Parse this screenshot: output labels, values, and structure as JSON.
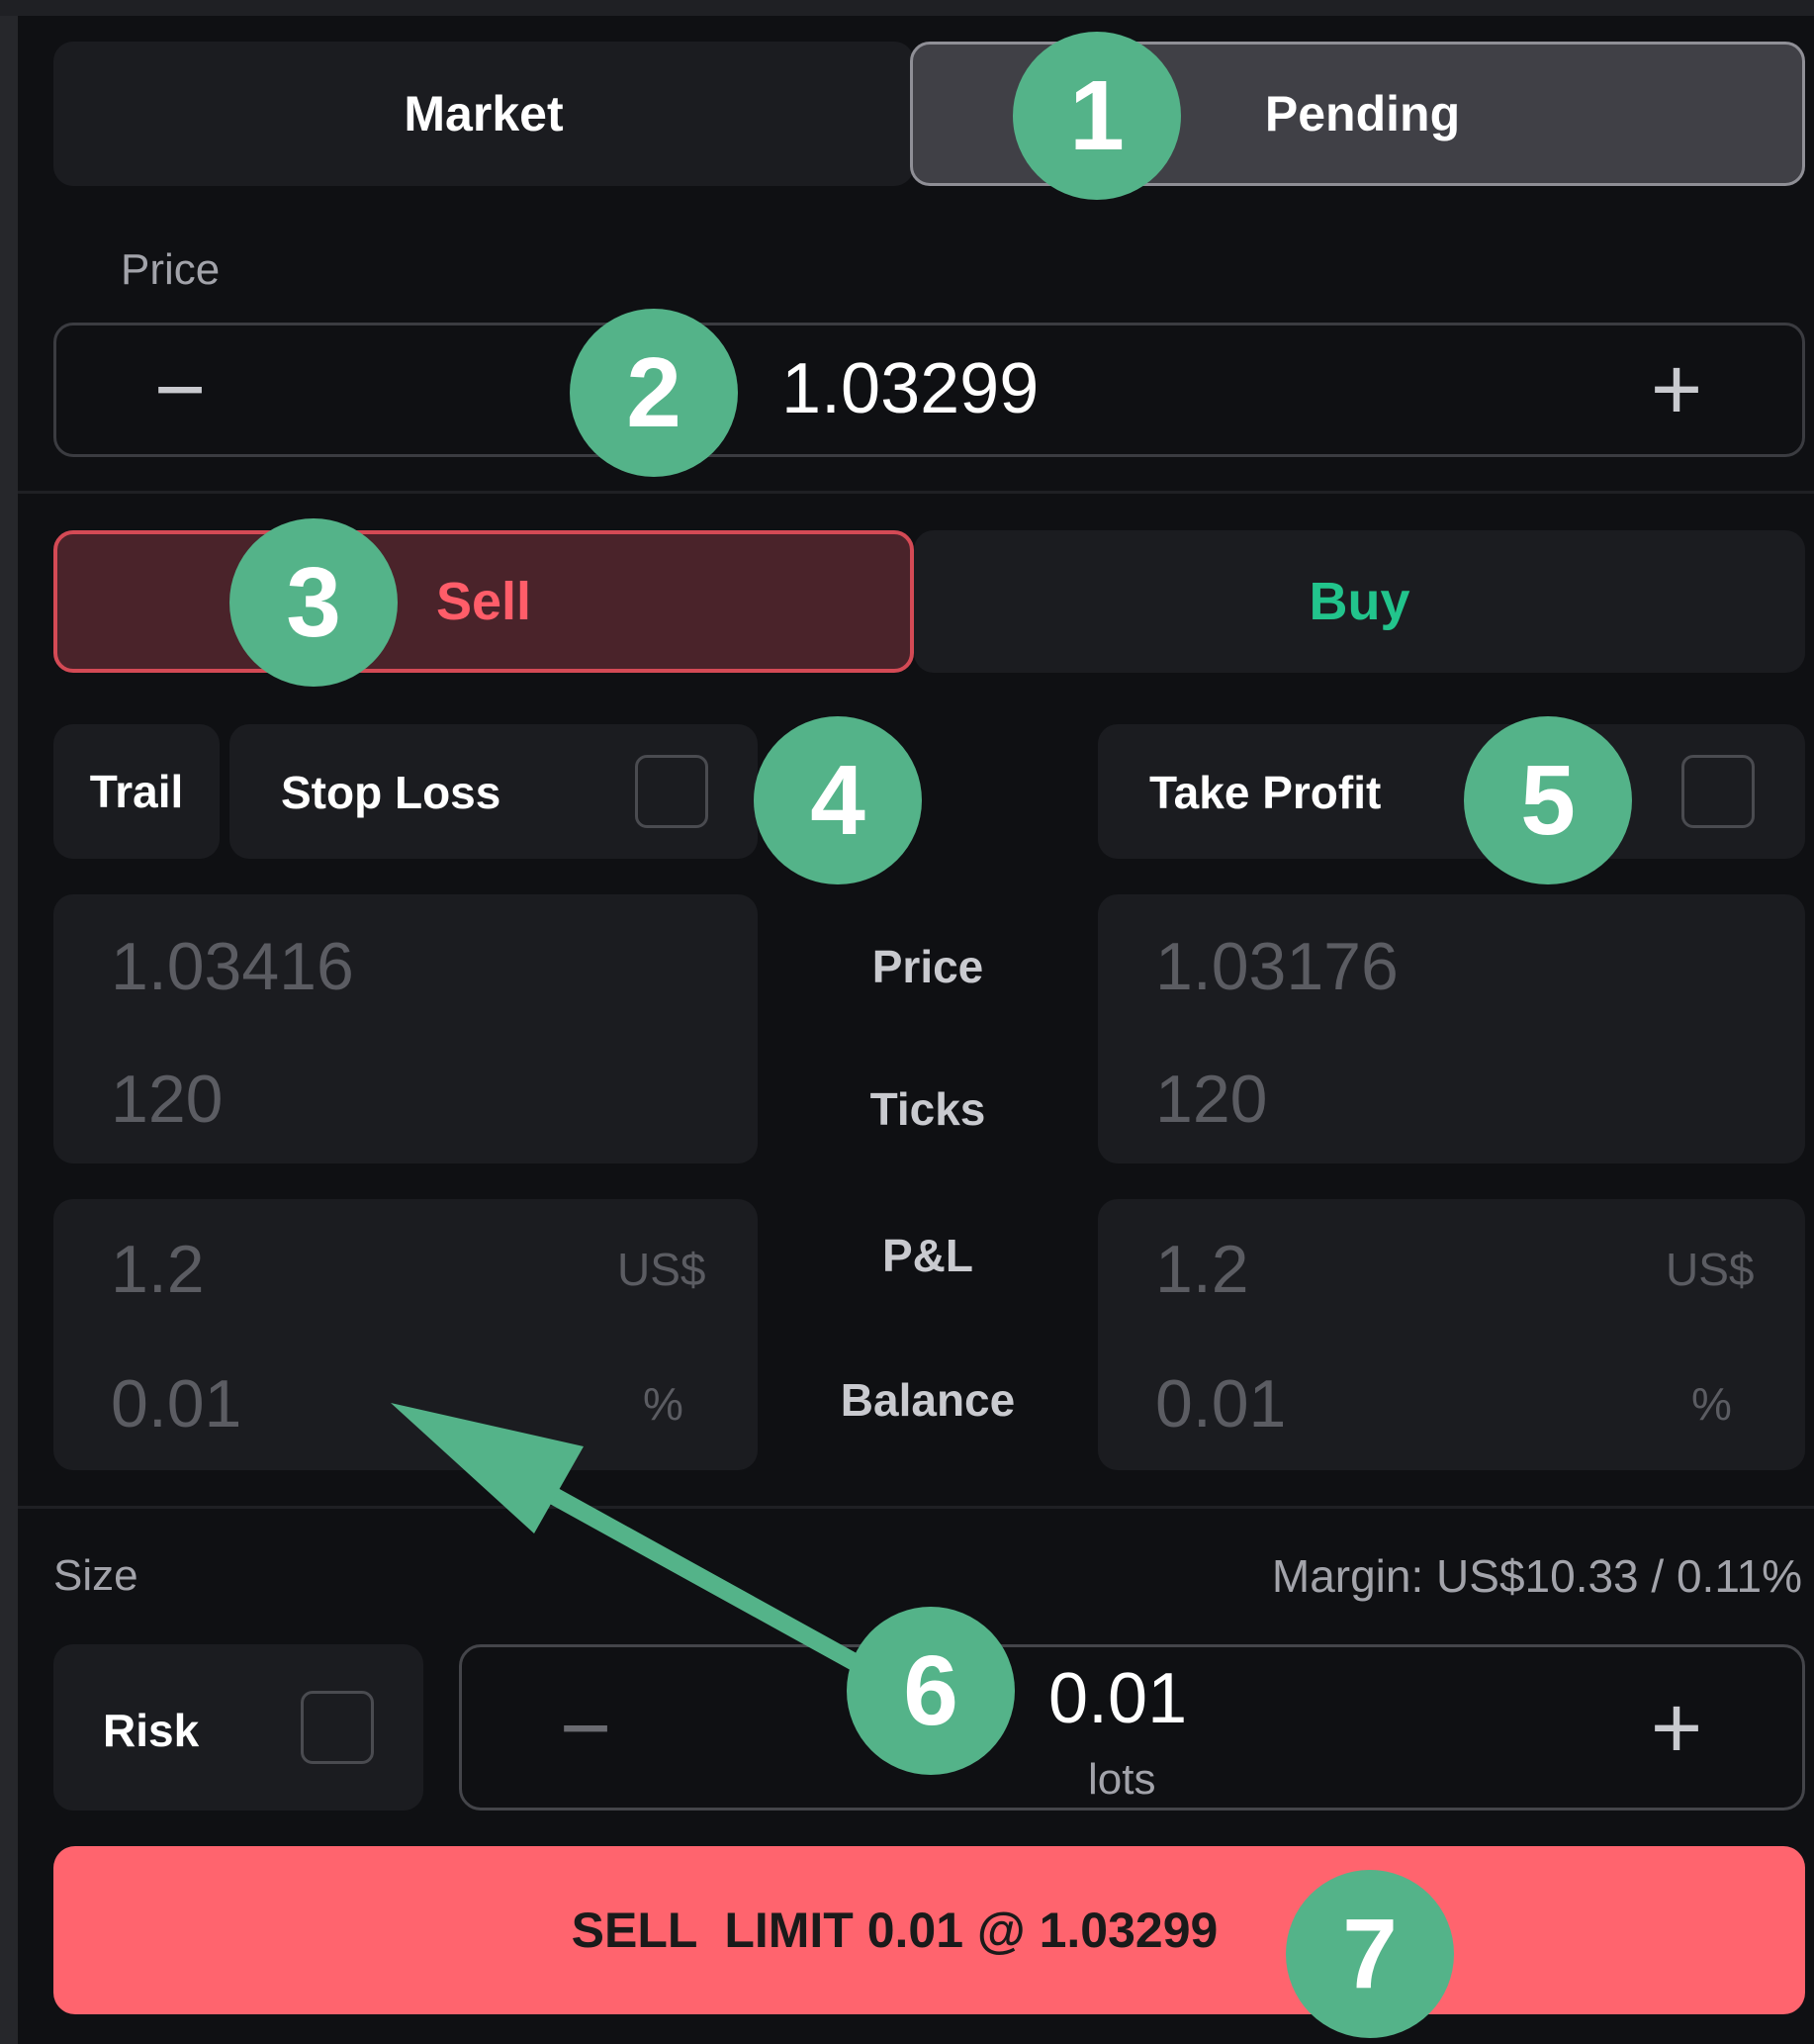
{
  "order_type_tabs": [
    {
      "label": "Market",
      "selected": false
    },
    {
      "label": "Pending",
      "selected": true
    }
  ],
  "price": {
    "label": "Price",
    "value": "1.03299",
    "minus_glyph": "−",
    "plus_glyph": "+"
  },
  "side": {
    "sell_label": "Sell",
    "buy_label": "Buy",
    "selected": "Sell"
  },
  "stop_loss": {
    "trail_label": "Trail",
    "label": "Stop Loss",
    "enabled": false,
    "price": "1.03416",
    "ticks": "120",
    "pnl": "1.2",
    "pnl_unit": "US$",
    "balance": "0.01",
    "balance_unit": "%"
  },
  "take_profit": {
    "label": "Take Profit",
    "enabled": false,
    "price": "1.03176",
    "ticks": "120",
    "pnl": "1.2",
    "pnl_unit": "US$",
    "balance": "0.01",
    "balance_unit": "%"
  },
  "row_labels": {
    "price": "Price",
    "ticks": "Ticks",
    "pnl": "P&L",
    "balance": "Balance"
  },
  "size": {
    "label": "Size",
    "margin": "Margin: US$10.33 / 0.11%",
    "risk_label": "Risk",
    "risk_enabled": false,
    "value": "0.01",
    "unit": "lots",
    "minus_glyph": "−",
    "plus_glyph": "+"
  },
  "submit": {
    "label": "SELL  LIMIT 0.01 @ 1.03299",
    "color": "#ff646e"
  },
  "annotations": [
    "1",
    "2",
    "3",
    "4",
    "5",
    "6",
    "7"
  ],
  "colors": {
    "background": "#0f1013",
    "panel": "#1b1c20",
    "sell": "#ff5d69",
    "buy": "#22c48c",
    "badge": "#54b389"
  }
}
